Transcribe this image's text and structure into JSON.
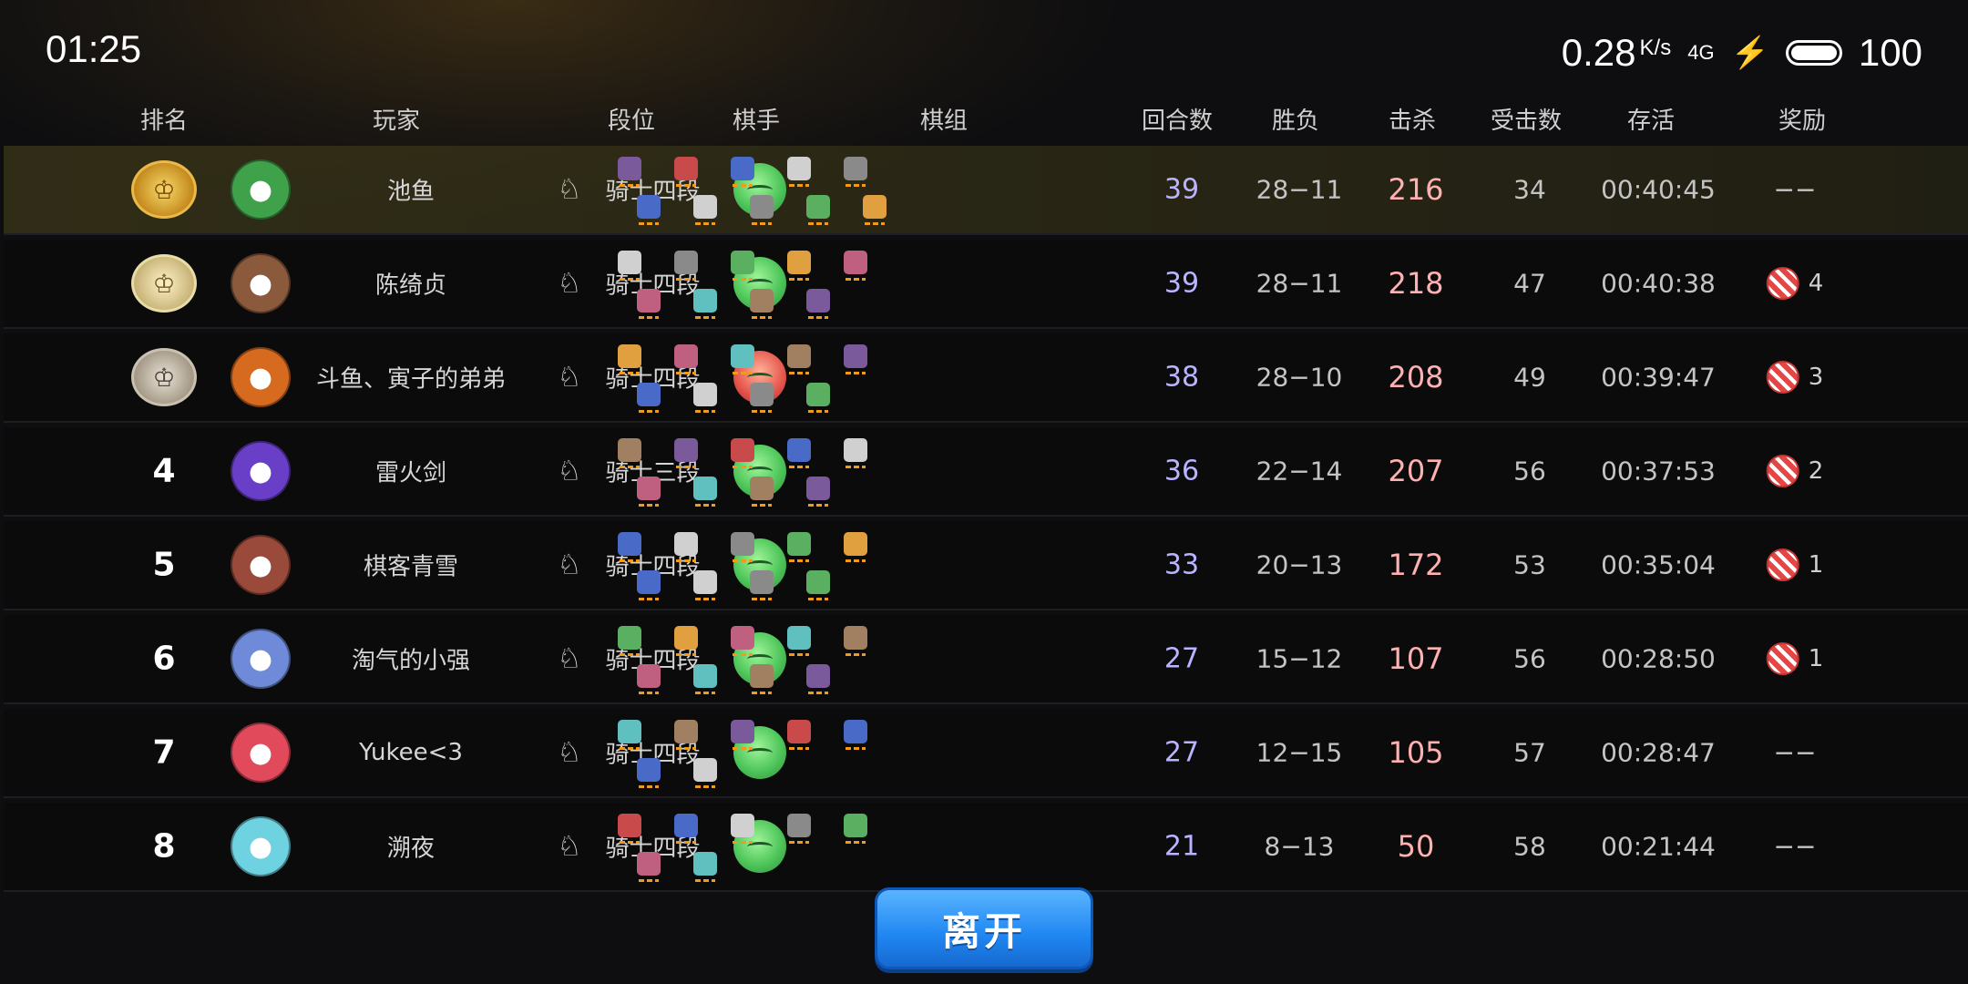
{
  "status": {
    "time": "01:25",
    "speed": "0.28",
    "speed_unit": "K/s",
    "network": "4G",
    "battery": "100"
  },
  "headers": {
    "rank": "排名",
    "player": "玩家",
    "tier": "段位",
    "tactician": "棋手",
    "comp": "棋组",
    "rounds": "回合数",
    "winloss": "胜负",
    "kills": "击杀",
    "hits_taken": "受击数",
    "survival": "存活",
    "reward": "奖励"
  },
  "rows": [
    {
      "rank": "1",
      "name": "池鱼",
      "tier": "骑士四段",
      "rounds": "39",
      "wl": "28−11",
      "kills": "216",
      "hits": "34",
      "survival": "00:40:45",
      "reward": "−−",
      "avatar_color": "#3fa24a",
      "tactician": "green"
    },
    {
      "rank": "2",
      "name": "陈绮贞",
      "tier": "骑士四段",
      "rounds": "39",
      "wl": "28−11",
      "kills": "218",
      "hits": "47",
      "survival": "00:40:38",
      "reward": "4",
      "avatar_color": "#8b5a3c",
      "tactician": "green"
    },
    {
      "rank": "3",
      "name": "斗鱼、寅子的弟弟",
      "tier": "骑士四段",
      "rounds": "38",
      "wl": "28−10",
      "kills": "208",
      "hits": "49",
      "survival": "00:39:47",
      "reward": "3",
      "avatar_color": "#d66a1e",
      "tactician": "red"
    },
    {
      "rank": "4",
      "name": "雷火剑",
      "tier": "骑士三段",
      "rounds": "36",
      "wl": "22−14",
      "kills": "207",
      "hits": "56",
      "survival": "00:37:53",
      "reward": "2",
      "avatar_color": "#6a3fc8",
      "tactician": "green"
    },
    {
      "rank": "5",
      "name": "棋客青雪",
      "tier": "骑士四段",
      "rounds": "33",
      "wl": "20−13",
      "kills": "172",
      "hits": "53",
      "survival": "00:35:04",
      "reward": "1",
      "avatar_color": "#9a4a3a",
      "tactician": "green"
    },
    {
      "rank": "6",
      "name": "淘气的小强",
      "tier": "骑士四段",
      "rounds": "27",
      "wl": "15−12",
      "kills": "107",
      "hits": "56",
      "survival": "00:28:50",
      "reward": "1",
      "avatar_color": "#6e8ad8",
      "tactician": "green"
    },
    {
      "rank": "7",
      "name": "Yukee<3",
      "tier": "骑士四段",
      "rounds": "27",
      "wl": "12−15",
      "kills": "105",
      "hits": "57",
      "survival": "00:28:47",
      "reward": "−−",
      "avatar_color": "#e04a5a",
      "tactician": "green"
    },
    {
      "rank": "8",
      "name": "溯夜",
      "tier": "骑士四段",
      "rounds": "21",
      "wl": "8−13",
      "kills": "50",
      "hits": "58",
      "survival": "00:21:44",
      "reward": "−−",
      "avatar_color": "#6fd2e0",
      "tactician": "green"
    }
  ],
  "leave_button": "离开"
}
